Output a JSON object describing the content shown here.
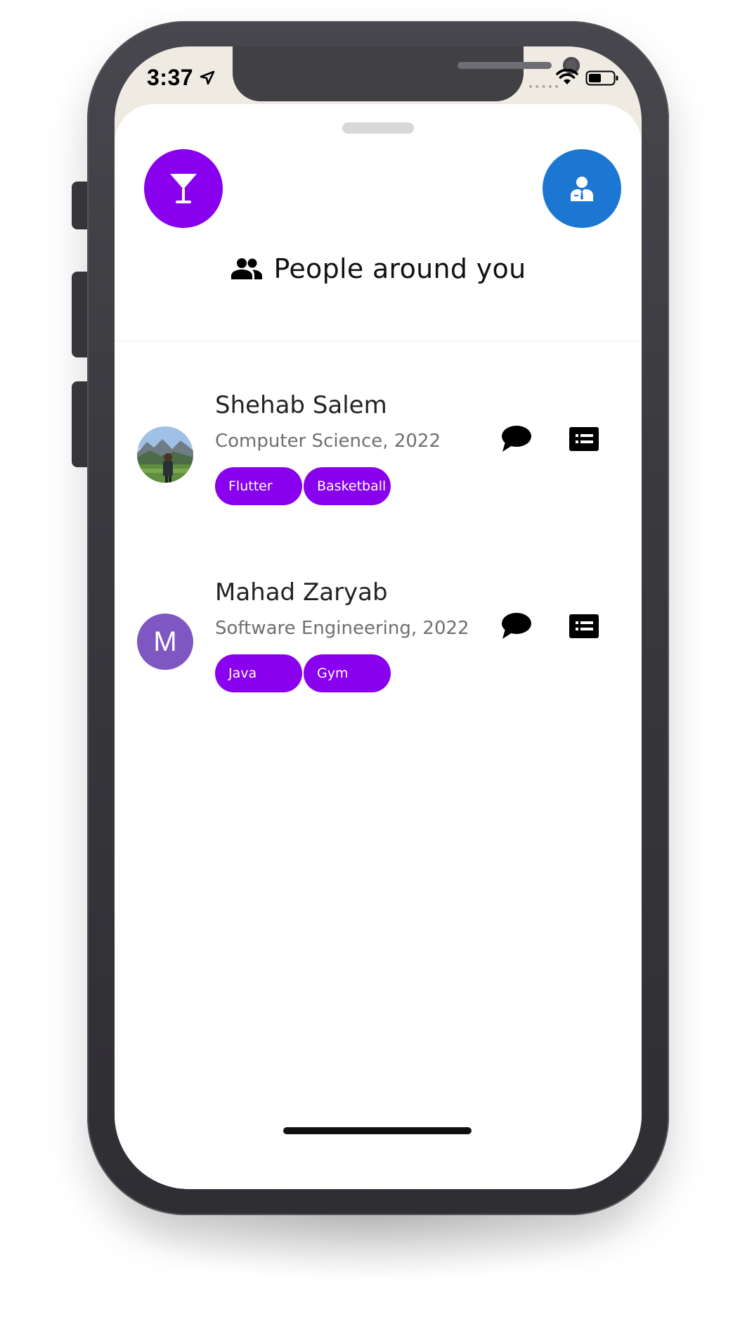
{
  "status_bar": {
    "time": "3:37",
    "signal_dots": "•••••"
  },
  "header": {
    "left_button_icon": "cocktail-glass-icon",
    "right_button_icon": "person-in-suit-icon",
    "title": "People around you",
    "title_icon": "people-group-icon"
  },
  "people": [
    {
      "name": "Shehab Salem",
      "subtitle": "Computer Science, 2022",
      "avatar_type": "photo",
      "avatar_letter": "",
      "tags": [
        "Flutter",
        "Basketball"
      ]
    },
    {
      "name": "Mahad Zaryab",
      "subtitle": "Software Engineering, 2022",
      "avatar_type": "letter",
      "avatar_letter": "M",
      "tags": [
        "Java",
        "Gym"
      ]
    }
  ],
  "row_actions": {
    "chat_icon": "chat-bubble-icon",
    "profile_icon": "profile-card-icon"
  },
  "colors": {
    "accent_purple": "#8800EE",
    "accent_blue": "#1C77D2",
    "avatar_purple": "#7E57C2"
  }
}
